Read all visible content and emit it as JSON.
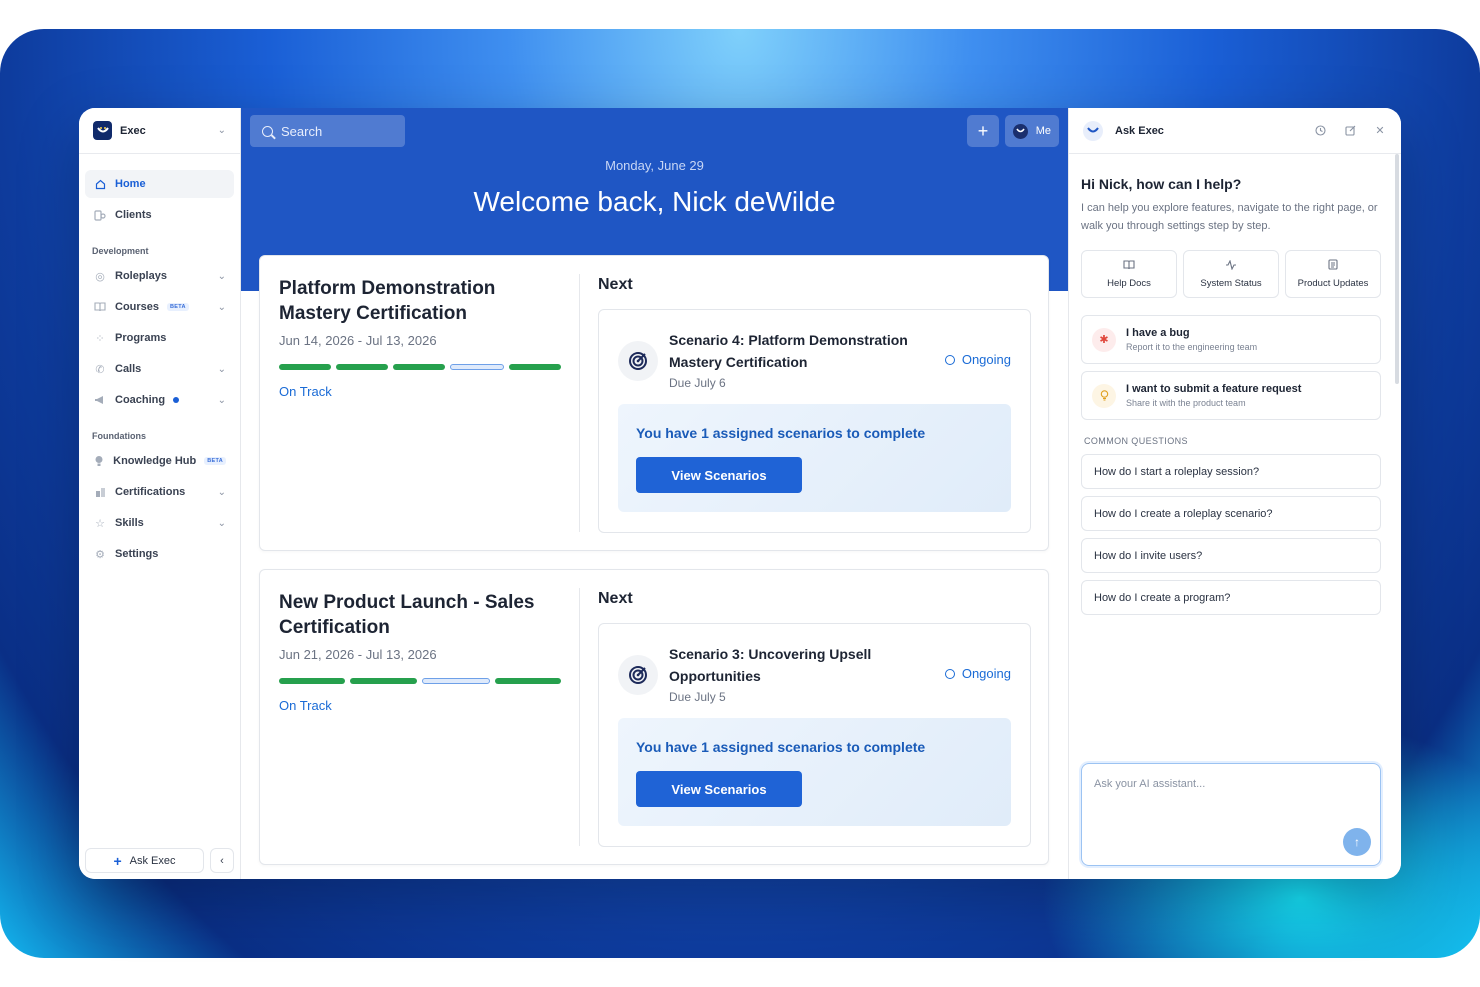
{
  "sidebar": {
    "workspace": "Exec",
    "nav_main": [
      {
        "label": "Home",
        "icon": "home-icon"
      },
      {
        "label": "Clients",
        "icon": "clients-icon"
      }
    ],
    "section_development": "Development",
    "nav_dev": [
      {
        "label": "Roleplays",
        "icon": "roleplays-icon"
      },
      {
        "label": "Courses",
        "badge": "BETA",
        "icon": "book-icon"
      },
      {
        "label": "Programs",
        "icon": "programs-icon"
      },
      {
        "label": "Calls",
        "icon": "phone-icon"
      },
      {
        "label": "Coaching",
        "icon": "megaphone-icon"
      }
    ],
    "section_foundations": "Foundations",
    "nav_foundations": [
      {
        "label": "Knowledge Hub",
        "badge": "BETA",
        "icon": "lightbulb-icon"
      },
      {
        "label": "Certifications",
        "icon": "certificate-icon"
      },
      {
        "label": "Skills",
        "icon": "star-icon"
      },
      {
        "label": "Settings",
        "icon": "gear-icon"
      }
    ],
    "ask_button": "Ask Exec"
  },
  "topbar": {
    "search_placeholder": "Search",
    "me_label": "Me"
  },
  "hero": {
    "date": "Monday, June 29",
    "title": "Welcome back, Nick deWilde"
  },
  "certifications": [
    {
      "title": "Platform Demonstration Mastery Certification",
      "dates": "Jun 14, 2026 - Jul 13, 2026",
      "status": "On Track",
      "next_label": "Next",
      "scenario": {
        "title": "Scenario 4: Platform Demonstration Mastery Certification",
        "due": "Due July 6",
        "state": "Ongoing"
      },
      "assigned_text": "You have 1 assigned scenarios to complete",
      "button": "View Scenarios"
    },
    {
      "title": "New Product Launch - Sales Certification",
      "dates": "Jun 21, 2026 - Jul 13, 2026",
      "status": "On Track",
      "next_label": "Next",
      "scenario": {
        "title": "Scenario 3: Uncovering Upsell Opportunities",
        "due": "Due July 5",
        "state": "Ongoing"
      },
      "assigned_text": "You have 1 assigned scenarios to complete",
      "button": "View Scenarios"
    }
  ],
  "panel": {
    "title": "Ask Exec",
    "greeting": "Hi Nick, how can I help?",
    "subtitle": "I can help you explore features, navigate to the right page, or walk you through settings step by step.",
    "quick_links": [
      "Help Docs",
      "System Status",
      "Product Updates"
    ],
    "actions": [
      {
        "title": "I have a bug",
        "subtitle": "Report it to the engineering team"
      },
      {
        "title": "I want to submit a feature request",
        "subtitle": "Share it with the product team"
      }
    ],
    "common_label": "COMMON QUESTIONS",
    "questions": [
      "How do I start a roleplay session?",
      "How do I create a roleplay scenario?",
      "How do I invite users?",
      "How do I create a program?"
    ],
    "input_placeholder": "Ask your AI assistant..."
  },
  "colors": {
    "brand_blue": "#1f56c4",
    "accent": "#1a5fd6",
    "progress_green": "#26a04d"
  }
}
